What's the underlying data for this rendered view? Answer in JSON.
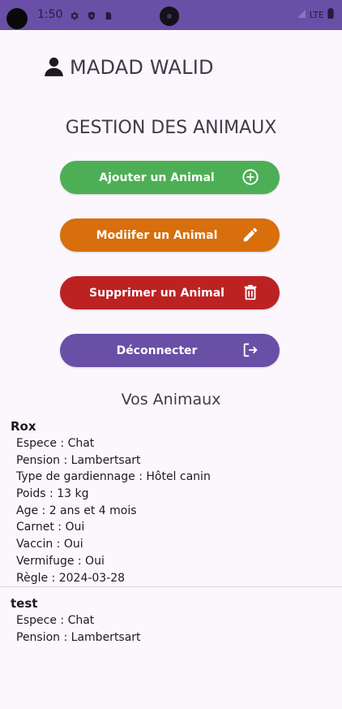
{
  "status": {
    "time": "1:50",
    "network": "LTE"
  },
  "user": {
    "name": "MADAD WALID"
  },
  "page": {
    "title": "GESTION DES ANIMAUX"
  },
  "buttons": {
    "add": "Ajouter un Animal",
    "edit": "Modiifer un Animal",
    "delete": "Supprimer un Animal",
    "logout": "Déconnecter"
  },
  "colors": {
    "add": "#4caf55",
    "edit": "#d86e0c",
    "delete": "#bd2223",
    "logout": "#6a4fa6",
    "statusbar": "#6a4fa6"
  },
  "section": {
    "title": "Vos Animaux"
  },
  "animals": [
    {
      "name": "Rox",
      "details": [
        "Espece : Chat",
        "Pension : Lambertsart",
        "Type de gardiennage : Hôtel canin",
        "Poids : 13 kg",
        "Age : 2 ans et 4 mois",
        "Carnet : Oui",
        "Vaccin : Oui",
        "Vermifuge : Oui",
        "Règle : 2024-03-28"
      ]
    },
    {
      "name": "test",
      "details": [
        "Espece : Chat",
        "Pension : Lambertsart"
      ]
    }
  ]
}
